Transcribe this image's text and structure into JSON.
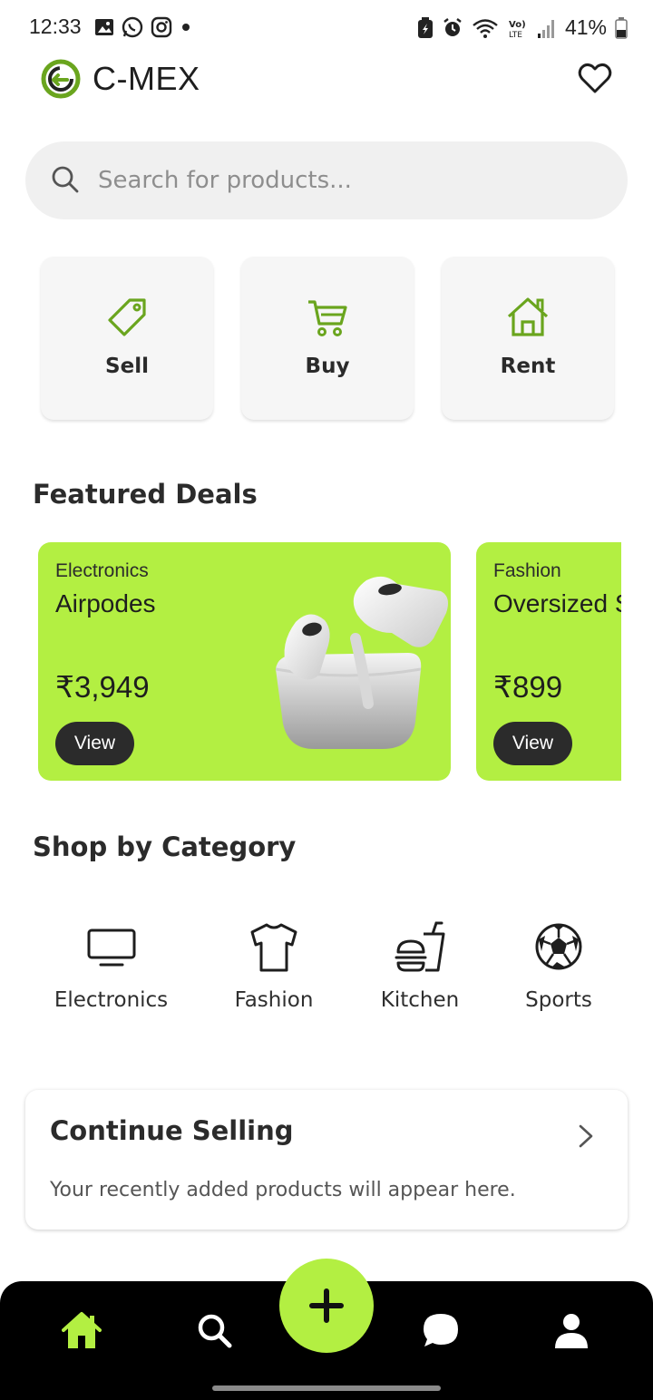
{
  "status_bar": {
    "time": "12:33",
    "battery": "41%",
    "left_icons": [
      "gallery-icon",
      "whatsapp-icon",
      "instagram-icon",
      "dot-icon"
    ],
    "right_icons": [
      "battery-saver-icon",
      "alarm-icon",
      "wifi-icon",
      "volte-icon",
      "signal-icon",
      "battery-icon"
    ]
  },
  "header": {
    "brand": "C-MEX",
    "favorite_icon": "heart-icon"
  },
  "search": {
    "placeholder": "Search for products...",
    "value": ""
  },
  "actions": [
    {
      "label": "Sell",
      "icon": "tag-icon"
    },
    {
      "label": "Buy",
      "icon": "cart-icon"
    },
    {
      "label": "Rent",
      "icon": "house-icon"
    }
  ],
  "featured": {
    "title": "Featured Deals",
    "deals": [
      {
        "category": "Electronics",
        "name": "Airpodes",
        "price": "₹3,949",
        "button": "View"
      },
      {
        "category": "Fashion",
        "name": "Oversized S",
        "price": "₹899",
        "button": "View"
      }
    ]
  },
  "categories": {
    "title": "Shop by Category",
    "items": [
      {
        "label": "Electronics",
        "icon": "monitor-icon"
      },
      {
        "label": "Fashion",
        "icon": "tshirt-icon"
      },
      {
        "label": "Kitchen",
        "icon": "burger-drink-icon"
      },
      {
        "label": "Sports",
        "icon": "football-icon"
      }
    ]
  },
  "continue_selling": {
    "title": "Continue Selling",
    "subtitle": "Your recently added products will appear here."
  },
  "bottom_nav": {
    "items": [
      "home-icon",
      "search-icon",
      "add-icon",
      "chat-icon",
      "profile-icon"
    ]
  },
  "colors": {
    "accent": "#b3ef42",
    "accent_icon": "#6aa51e",
    "dark": "#2b2b2b",
    "nav_background": "#000000"
  }
}
